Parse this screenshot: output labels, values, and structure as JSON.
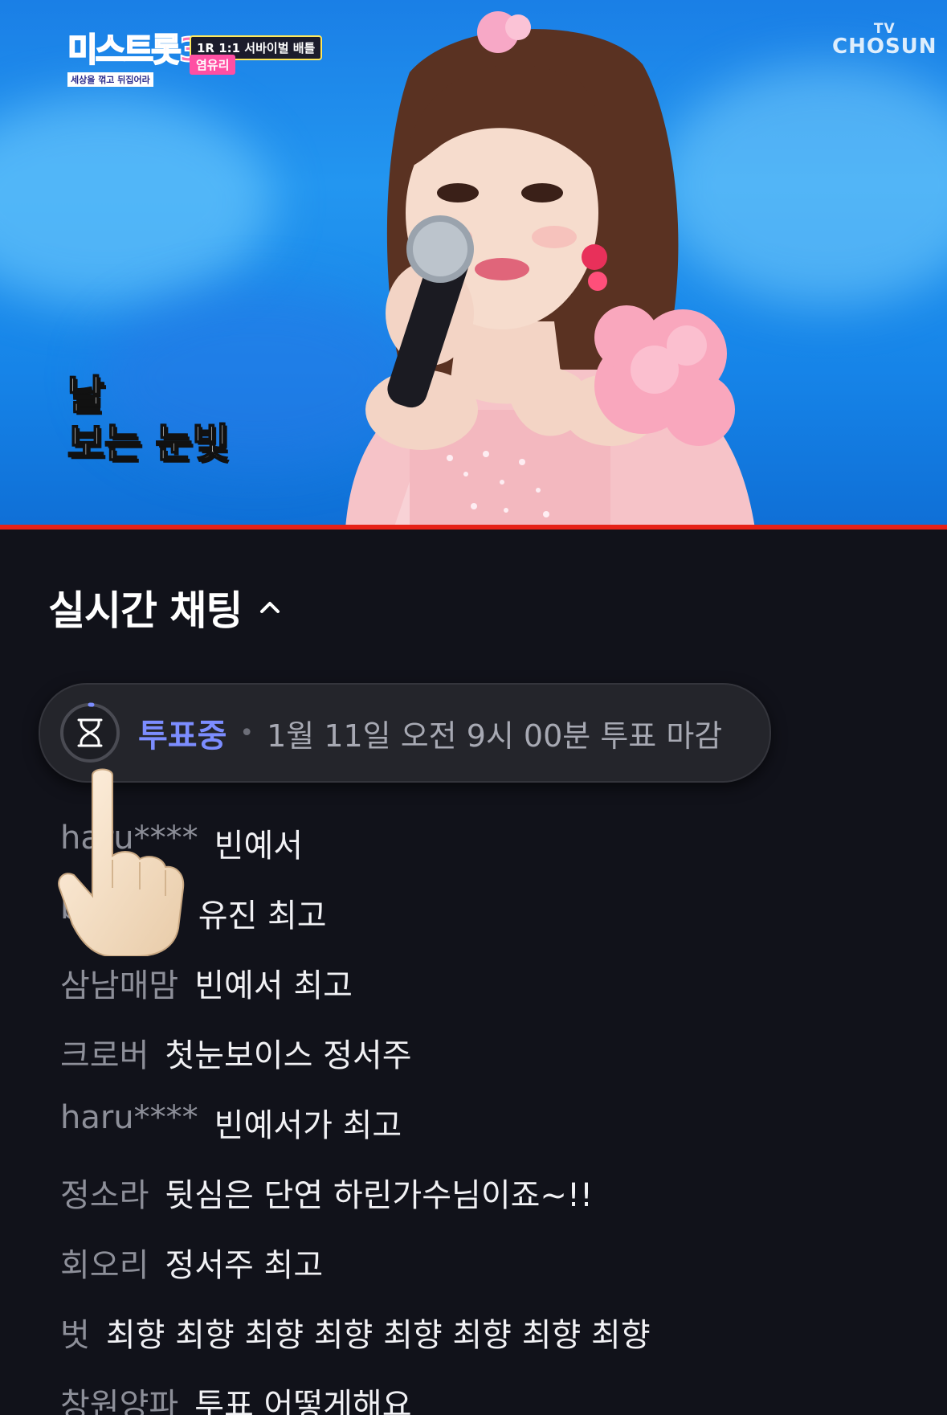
{
  "video": {
    "show_logo_text": "미스트롯3",
    "show_logo_subtext": "세상을 꺾고 뒤집어라",
    "round_tag": "1R 1:1 서바이벌 배틀",
    "singer_tag": "염유리",
    "broadcaster_top": "TV",
    "broadcaster_main": "CHOSUN",
    "subtitle_line1": "날",
    "subtitle_line2": "보는 눈빛",
    "progress_color": "#e62117"
  },
  "chat": {
    "title": "실시간 채팅",
    "vote_banner": {
      "status": "투표중",
      "separator": "•",
      "deadline": "1월 11일 오전 9시 00분 투표 마감",
      "icon": "hourglass-icon"
    },
    "messages": [
      {
        "user": "haru****",
        "message": "빈예서"
      },
      {
        "user": "bs2****",
        "message": "유진 최고"
      },
      {
        "user": "삼남매맘",
        "message": "빈예서 최고"
      },
      {
        "user": "크로버",
        "message": "첫눈보이스 정서주"
      },
      {
        "user": "haru****",
        "message": "빈예서가 최고"
      },
      {
        "user": "정소라",
        "message": "뒷심은 단연 하린가수님이죠~!!"
      },
      {
        "user": "회오리",
        "message": "정서주 최고"
      },
      {
        "user": "벗",
        "message": "최향 최향 최향 최향 최향 최향 최향 최향"
      },
      {
        "user": "창원양파",
        "message": "투표 어떻게해요"
      }
    ]
  },
  "colors": {
    "background": "#11121a",
    "accent_vote": "#7c8dff",
    "username": "#8d8f99",
    "message": "#f1f1f4"
  }
}
